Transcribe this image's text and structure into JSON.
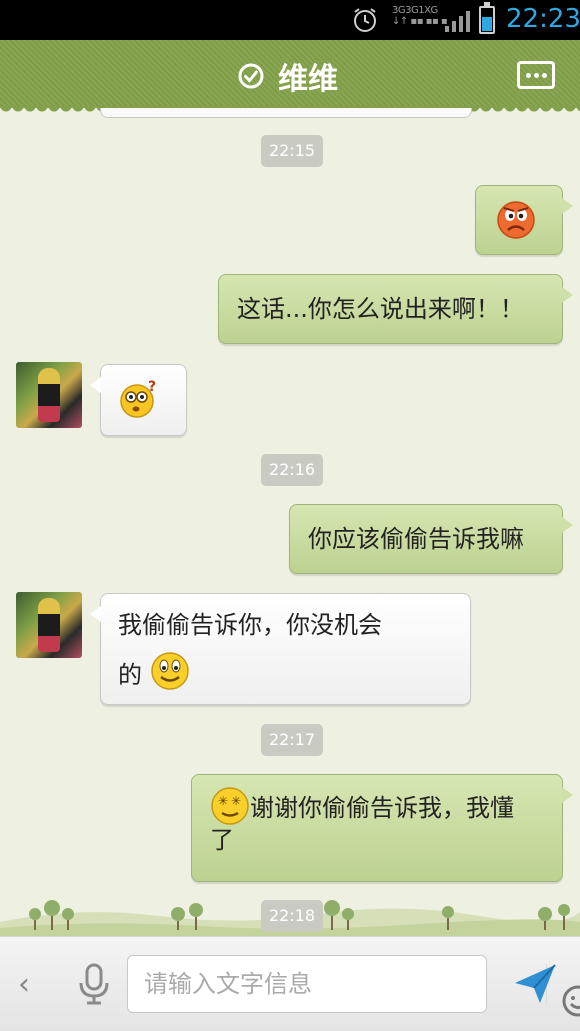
{
  "status_bar": {
    "time": "22:23",
    "network_labels": [
      "3G",
      "3G",
      "1X",
      "G"
    ],
    "icons": [
      "alarm-icon",
      "signal-icon",
      "battery-icon"
    ],
    "accent_color": "#2fa7e0"
  },
  "header": {
    "title": "维维",
    "status_icon": "online-check-icon",
    "menu_icon": "more-menu-icon",
    "background_color": "#83a04c"
  },
  "messages": {
    "ts1": "22:15",
    "m1_emoji": "angry-face-emoji",
    "m2_text": "这话...你怎么说出来啊！！",
    "m3_emoji": "confused-question-emoji",
    "ts2": "22:16",
    "m4_text": "你应该偷偷告诉我嘛",
    "m5_text_line1": "我偷偷告诉你，你没机会",
    "m5_text_line2": "的",
    "m5_emoji": "smile-emoji",
    "ts3": "22:17",
    "m6_emoji": "dizzy-eyes-emoji",
    "m6_text_line1": "谢谢你偷偷告诉我，我懂",
    "m6_text_line2": "了",
    "ts4": "22:18"
  },
  "input_bar": {
    "placeholder": "请输入文字信息",
    "value": "",
    "back_label": "‹",
    "icons": [
      "back-chevron-icon",
      "microphone-icon",
      "emoji-picker-icon",
      "send-icon"
    ]
  },
  "colors": {
    "outgoing_bubble": "#c8dc9e",
    "incoming_bubble": "#ffffff",
    "chat_background": "#eef1e2",
    "timestamp_chip": "#c9cbc2"
  }
}
